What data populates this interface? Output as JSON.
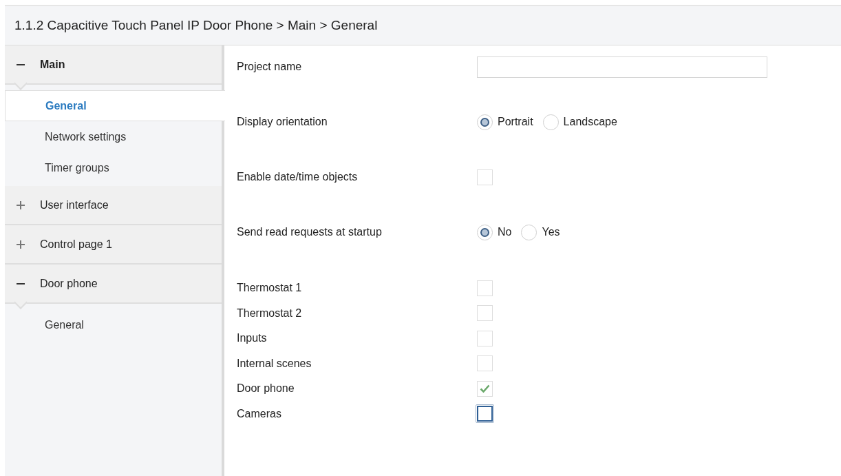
{
  "header": {
    "title": "1.1.2 Capacitive Touch Panel IP Door Phone > Main > General"
  },
  "sidebar": {
    "groups": [
      {
        "label": "Main",
        "expanded": true,
        "children": [
          {
            "label": "General",
            "selected": true
          },
          {
            "label": "Network settings",
            "selected": false
          },
          {
            "label": "Timer groups",
            "selected": false
          }
        ]
      },
      {
        "label": "User interface",
        "expanded": false
      },
      {
        "label": "Control page 1",
        "expanded": false
      },
      {
        "label": "Door phone",
        "expanded": true,
        "children": [
          {
            "label": "General",
            "selected": false
          }
        ]
      }
    ]
  },
  "settings": [
    {
      "kind": "text",
      "label": "Project name"
    },
    {
      "kind": "radio",
      "label": "Display orientation",
      "options": [
        {
          "label": "Portrait",
          "selected": true
        },
        {
          "label": "Landscape",
          "selected": false
        }
      ]
    },
    {
      "kind": "checkbox",
      "label": "Enable date/time objects",
      "checked": false,
      "focused": false
    },
    {
      "kind": "radio",
      "label": "Send read requests at startup",
      "options": [
        {
          "label": "No",
          "selected": true
        },
        {
          "label": "Yes",
          "selected": false
        }
      ]
    }
  ],
  "modules": [
    {
      "label": "Thermostat 1",
      "checked": false,
      "focused": false
    },
    {
      "label": "Thermostat 2",
      "checked": false,
      "focused": false
    },
    {
      "label": "Inputs",
      "checked": false,
      "focused": false
    },
    {
      "label": "Internal scenes",
      "checked": false,
      "focused": false
    },
    {
      "label": "Door phone",
      "checked": true,
      "focused": false
    },
    {
      "label": "Cameras",
      "checked": false,
      "focused": true
    }
  ]
}
